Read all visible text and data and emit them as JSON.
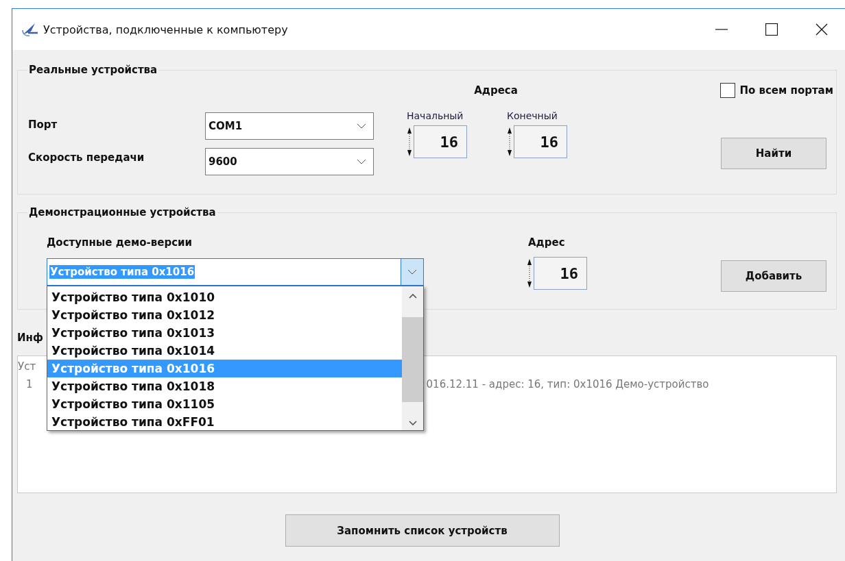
{
  "window": {
    "title": "Устройства, подключенные к компьютеру"
  },
  "real_devices": {
    "title": "Реальные устройства",
    "port_label": "Порт",
    "port_value": "COM1",
    "speed_label": "Скорость передачи",
    "speed_value": "9600",
    "addresses_label": "Адреса",
    "start_label": "Начальный",
    "start_value": "16",
    "end_label": "Конечный",
    "end_value": "16",
    "all_ports": {
      "label": "По всем портам",
      "checked": false
    },
    "find_button": "Найти"
  },
  "demo_devices": {
    "title": "Демонстрационные устройства",
    "available_label": "Доступные демо-версии",
    "selected_value": "Устройство типа 0x1016",
    "address_label": "Адрес",
    "address_value": "16",
    "add_button": "Добавить",
    "dropdown_items": [
      {
        "label": "Устройство типа 0x1010",
        "selected": false
      },
      {
        "label": "Устройство типа 0x1012",
        "selected": false
      },
      {
        "label": "Устройство типа 0x1013",
        "selected": false
      },
      {
        "label": "Устройство типа 0x1014",
        "selected": false
      },
      {
        "label": "Устройство типа 0x1016",
        "selected": true
      },
      {
        "label": "Устройство типа 0x1018",
        "selected": false
      },
      {
        "label": "Устройство типа 0x1105",
        "selected": false
      },
      {
        "label": "Устройство типа 0xFF01",
        "selected": false
      }
    ]
  },
  "info": {
    "label": "Инф",
    "line_1": "Уст",
    "line_2_start": "1",
    "line_2_end": "016.12.11 - адрес: 16, тип: 0x1016 Демо-устройство"
  },
  "save_button": "Запомнить список устройств"
}
